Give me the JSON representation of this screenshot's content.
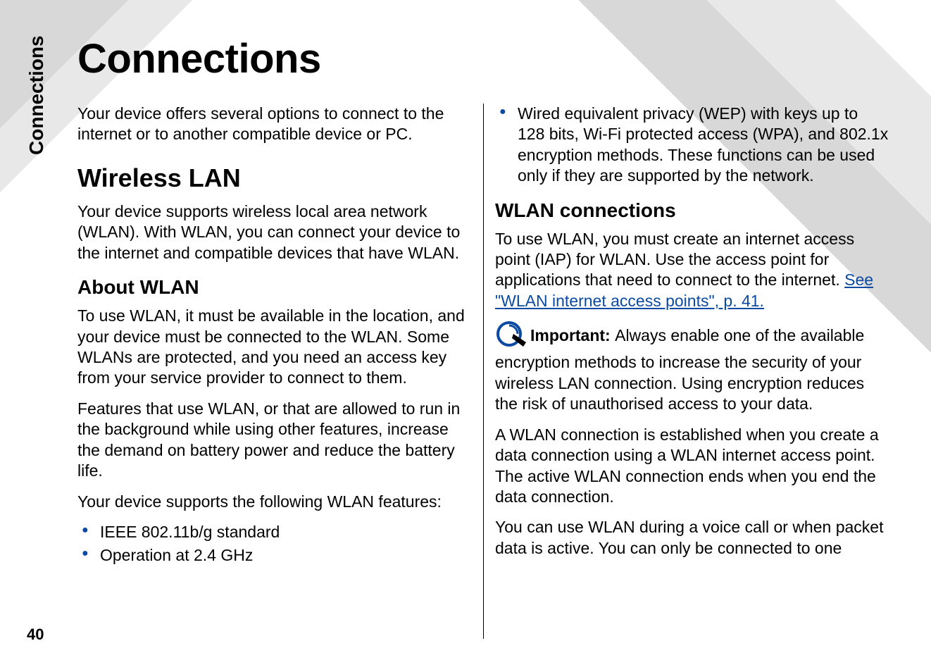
{
  "sidebar": {
    "section_label": "Connections",
    "page_number": "40"
  },
  "title": "Connections",
  "intro": "Your device offers several options to connect to the internet or to another compatible device or PC.",
  "wireless_lan": {
    "heading": "Wireless LAN",
    "para": "Your device supports wireless local area network (WLAN). With WLAN, you can connect your device to the internet and compatible devices that have WLAN."
  },
  "about_wlan": {
    "heading": "About WLAN",
    "para1": "To use WLAN, it must be available in the location, and your device must be connected to the WLAN. Some WLANs are protected, and you need an access key from your service provider to connect to them.",
    "para2": "Features that use WLAN, or that are allowed to run in the background while using other features, increase the demand on battery power and reduce the battery life.",
    "para3": "Your device supports the following WLAN features:",
    "bullets": [
      "IEEE 802.11b/g standard",
      "Operation at 2.4 GHz",
      "Wired equivalent privacy (WEP) with keys up to 128 bits, Wi-Fi protected access (WPA), and 802.1x encryption methods. These functions can be used only if they are supported by the network."
    ]
  },
  "wlan_connections": {
    "heading": "WLAN connections",
    "para1": "To use WLAN, you must create an internet access point (IAP) for WLAN. Use the access point for applications that need to connect to the internet. ",
    "link_text": "See \"WLAN internet access points\", p. 41.",
    "important_label": "Important: ",
    "important_text": "Always enable one of the available encryption methods to increase the security of your wireless LAN connection. Using encryption reduces the risk of unauthorised access to your data.",
    "para2": "A WLAN connection is established when you create a data connection using a WLAN internet access point. The active WLAN connection ends when you end the data connection.",
    "para3": "You can use WLAN during a voice call or when packet data is active. You can only be connected to one"
  }
}
